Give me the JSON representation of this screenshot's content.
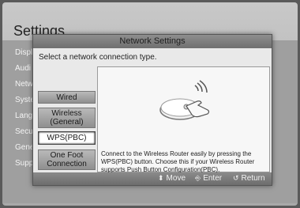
{
  "background": {
    "title": "Settings",
    "menu": [
      "Displ",
      "Audi",
      "Netw",
      "Syste",
      "Lang",
      "Secu",
      "Gene",
      "Supp"
    ]
  },
  "dialog": {
    "title": "Network Settings",
    "prompt": "Select a network connection type.",
    "options": [
      {
        "label": "Wired"
      },
      {
        "label": "Wireless (General)"
      },
      {
        "label": "WPS(PBC)",
        "selected": true
      },
      {
        "label": "One Foot Connection"
      }
    ],
    "description": "Connect to the Wireless Router easily by pressing the WPS(PBC) button. Choose this if your Wireless Router supports Push Button Configuration(PBC).",
    "footer": {
      "move": "Move",
      "enter": "Enter",
      "return": "Return",
      "move_icon": "up-down-arrow-icon",
      "enter_icon": "enter-icon",
      "return_icon": "return-icon"
    }
  }
}
